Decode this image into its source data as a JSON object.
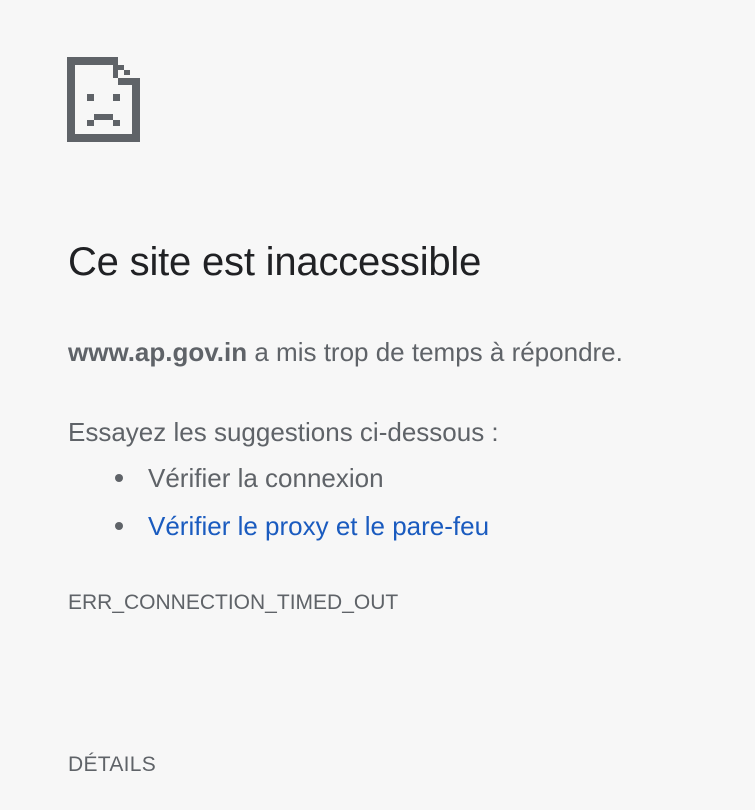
{
  "icon": "sad-page-icon",
  "title": "Ce site est inaccessible",
  "message": {
    "domain": "www.ap.gov.in",
    "text": " a mis trop de temps à répondre."
  },
  "suggestions": {
    "heading": "Essayez les suggestions ci-dessous :",
    "items": [
      {
        "label": "Vérifier la connexion",
        "link": false
      },
      {
        "label": "Vérifier le proxy et le pare-feu",
        "link": true
      }
    ]
  },
  "error_code": "ERR_CONNECTION_TIMED_OUT",
  "details_label": "DÉTAILS",
  "colors": {
    "background": "#f7f7f7",
    "title": "#202124",
    "text": "#5f6368",
    "link": "#1a5bbf"
  }
}
